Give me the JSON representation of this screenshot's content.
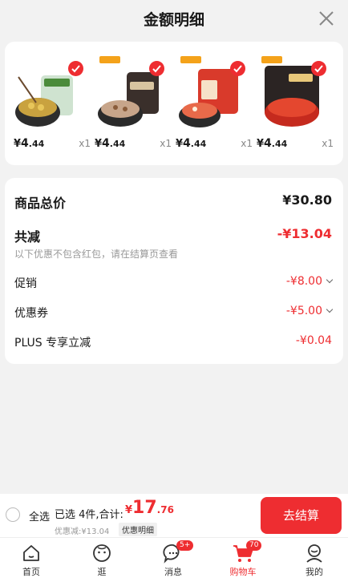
{
  "header": {
    "title": "金额明细"
  },
  "products": [
    {
      "price_yen": "¥",
      "price_int": "4",
      "price_dec": ".44",
      "qty": "x1",
      "thumb_text": "清油火锅底料"
    },
    {
      "price_yen": "¥",
      "price_int": "4",
      "price_dec": ".44",
      "qty": "x1",
      "thumb_text": "番茄火锅"
    },
    {
      "price_yen": "¥",
      "price_int": "4",
      "price_dec": ".44",
      "qty": "x1",
      "thumb_text": "麻辣火锅"
    },
    {
      "price_yen": "¥",
      "price_int": "4",
      "price_dec": ".44",
      "qty": "x1",
      "thumb_text": "小龙虾调料"
    }
  ],
  "summary": {
    "total_label": "商品总价",
    "total_value": "¥30.80",
    "reduce_label": "共减",
    "reduce_value": "-¥13.04",
    "note": "以下优惠不包含红包，请在结算页查看",
    "promo_label": "促销",
    "promo_value": "-¥8.00",
    "coupon_label": "优惠券",
    "coupon_value": "-¥5.00",
    "plus_label": "PLUS 专享立减",
    "plus_value": "-¥0.04"
  },
  "checkout": {
    "select_all": "全选",
    "selected_info": "已选 4件,合计:",
    "total_yen": "¥",
    "total_int": "17",
    "total_dec": ".76",
    "discount_line": "优惠减:¥13.04",
    "detail_tag": "优惠明细",
    "button": "去结算"
  },
  "tabs": [
    {
      "label": "首页",
      "icon": "home-icon"
    },
    {
      "label": "逛",
      "icon": "face-icon"
    },
    {
      "label": "消息",
      "icon": "message-icon",
      "badge": "5+"
    },
    {
      "label": "购物车",
      "icon": "cart-icon",
      "badge": "70"
    },
    {
      "label": "我的",
      "icon": "user-icon"
    }
  ],
  "colors": {
    "accent": "#ee2d31",
    "background": "#f2f2f2"
  }
}
